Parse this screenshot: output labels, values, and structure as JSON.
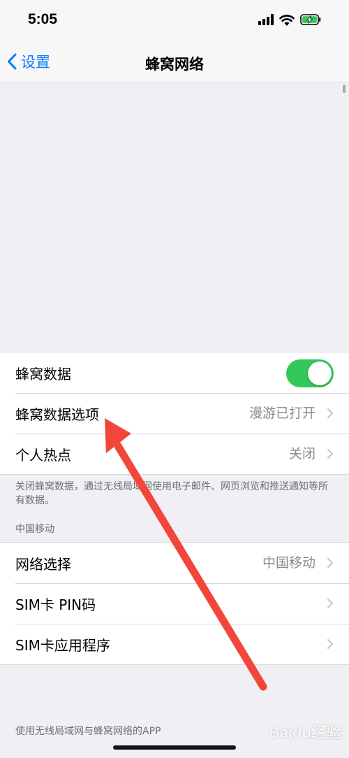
{
  "status_bar": {
    "time": "5:05"
  },
  "nav": {
    "back_label": "设置",
    "title": "蜂窝网络"
  },
  "cellular_group": {
    "rows": [
      {
        "label": "蜂窝数据",
        "toggle": "on"
      },
      {
        "label": "蜂窝数据选项",
        "value": "漫游已打开"
      },
      {
        "label": "个人热点",
        "value": "关闭"
      }
    ],
    "footer": "关闭蜂窝数据，通过无线局域网使用电子邮件、网页浏览和推送通知等所有数据。"
  },
  "carrier_group": {
    "header": "中国移动",
    "rows": [
      {
        "label": "网络选择",
        "value": "中国移动"
      },
      {
        "label": "SIM卡 PIN码"
      },
      {
        "label": "SIM卡应用程序"
      }
    ]
  },
  "wlan_section": {
    "header": "使用无线局域网与蜂窝网络的APP"
  },
  "watermark": "Baidu经验",
  "colors": {
    "accent": "#0a7aff",
    "toggle_on": "#34c759",
    "arrow": "#f2463b"
  }
}
